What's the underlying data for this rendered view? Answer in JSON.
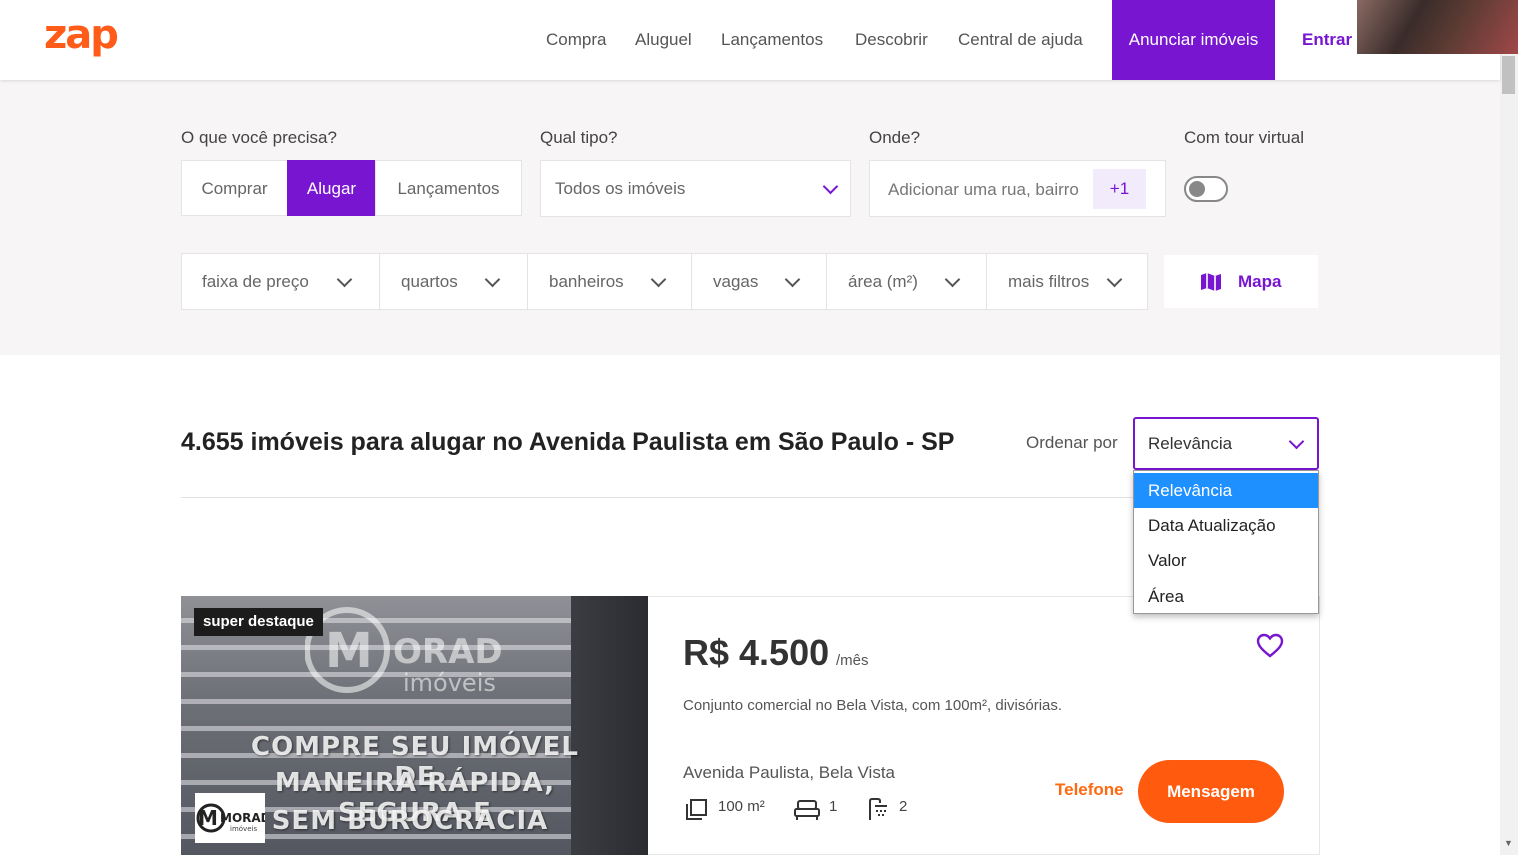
{
  "header": {
    "logo": "zap",
    "nav": [
      "Compra",
      "Aluguel",
      "Lançamentos",
      "Descobrir",
      "Central de ajuda"
    ],
    "advertise_label": "Anunciar imóveis",
    "login_label": "Entrar",
    "brand_color": "#7815d1",
    "accent_color": "#ff6a10"
  },
  "search": {
    "need_label": "O que você precisa?",
    "need_options": [
      "Comprar",
      "Alugar",
      "Lançamentos"
    ],
    "need_selected": "Alugar",
    "type_label": "Qual tipo?",
    "type_value": "Todos os imóveis",
    "where_label": "Onde?",
    "where_placeholder": "Adicionar uma rua, bairro",
    "where_extra": "+1",
    "tour_label": "Com tour virtual",
    "tour_enabled": false
  },
  "filters": {
    "items": [
      "faixa de preço",
      "quartos",
      "banheiros",
      "vagas",
      "área (m²)",
      "mais filtros"
    ],
    "map_label": "Mapa"
  },
  "results": {
    "title": "4.655 imóveis para alugar no Avenida Paulista em São Paulo - SP",
    "order_label": "Ordenar por",
    "order_value": "Relevância",
    "order_options": [
      "Relevância",
      "Data Atualização",
      "Valor",
      "Área"
    ],
    "order_highlighted": "Relevância"
  },
  "listing": {
    "badge": "super destaque",
    "watermark_brand": "ORAD",
    "watermark_sub": "imóveis",
    "watermark_lines": [
      "COMPRE SEU IMÓVEL DE",
      "MANEIRA RÁPIDA, SEGURA E",
      "SEM BUROCRACIA"
    ],
    "agency_logo": "MORAD",
    "agency_logo_sub": "imóveis",
    "price": "R$ 4.500",
    "period": "/mês",
    "description": "Conjunto comercial no Bela Vista, com 100m², divisórias.",
    "address": "Avenida Paulista, Bela Vista",
    "area": "100 m²",
    "bedrooms": "1",
    "bathrooms": "2",
    "phone_label": "Telefone",
    "message_label": "Mensagem"
  }
}
